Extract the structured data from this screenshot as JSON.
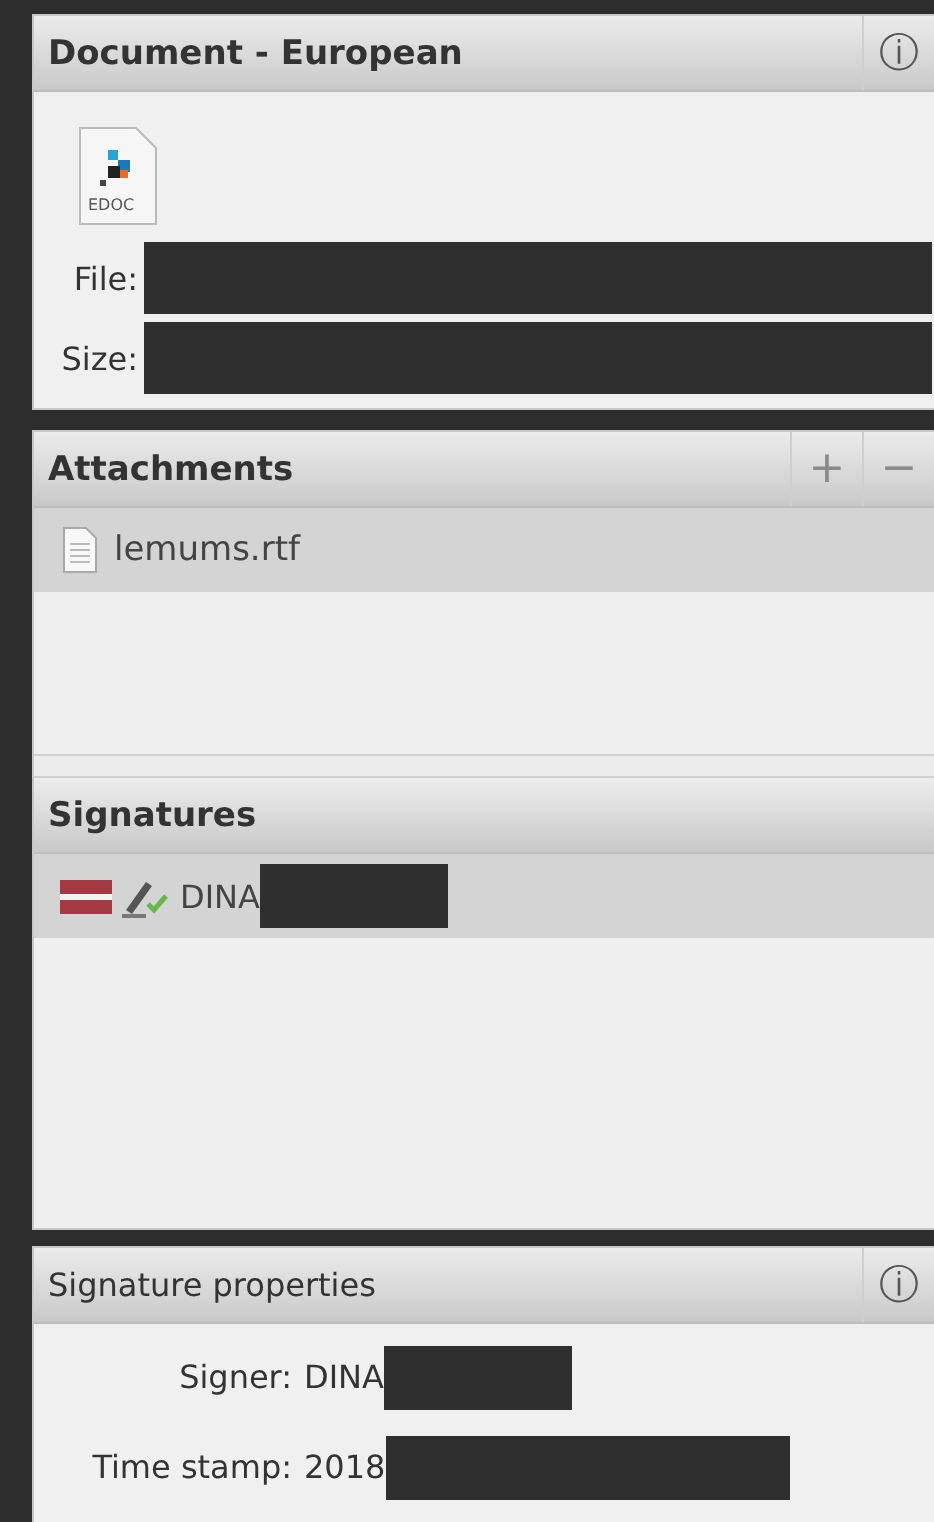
{
  "document": {
    "title": "Document - European",
    "info_button": "ⓘ",
    "file_type": "EDOC",
    "fields": [
      {
        "label": "File:",
        "redacted": true
      },
      {
        "label": "Size:",
        "redacted": true
      }
    ]
  },
  "attachments": {
    "title": "Attachments",
    "buttons": [
      "+",
      "−"
    ],
    "items": [
      {
        "name": "lemums.rtf",
        "selected": true
      }
    ]
  },
  "signatures": {
    "title": "Signatures",
    "items": [
      {
        "name": "DINA",
        "redacted": true,
        "selected": true,
        "valid": true
      }
    ]
  },
  "signature_properties": {
    "title": "Signature properties",
    "info_button": "ⓘ",
    "fields": [
      {
        "label": "Signer:",
        "value": "DINA",
        "redacted": true
      },
      {
        "label": "Time stamp:",
        "value": "2018",
        "redacted": true
      }
    ]
  }
}
